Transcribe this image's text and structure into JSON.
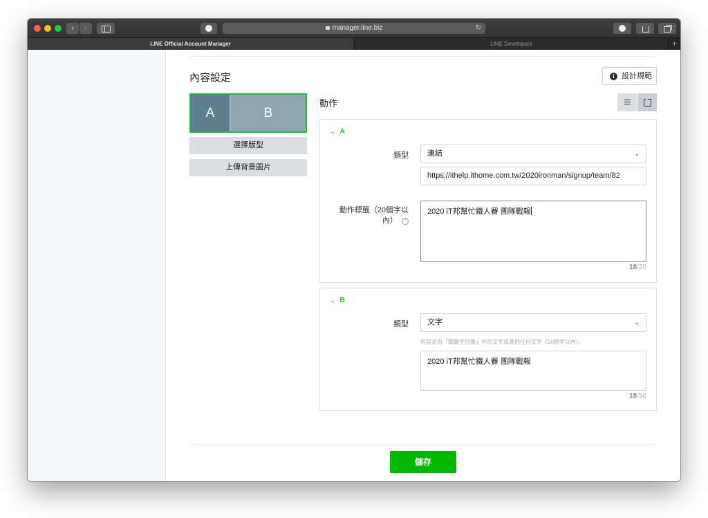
{
  "browser": {
    "url": "manager.line.biz",
    "tabs": [
      {
        "label": "LINE Official Account Manager",
        "active": true
      },
      {
        "label": "LINE Developers",
        "active": false
      }
    ],
    "new_tab_label": "+"
  },
  "page": {
    "title": "內容設定",
    "design_guide_label": "設計規範",
    "preview": {
      "cell_a": "A",
      "cell_b": "B"
    },
    "select_layout_label": "選擇版型",
    "upload_background_label": "上傳背景圖片",
    "actions_title": "動作",
    "save_label": "儲存"
  },
  "action_a": {
    "label": "A",
    "type_label": "類型",
    "type_value": "連結",
    "url_value": "https://ithelp.ithome.com.tw/2020ironman/signup/team/82",
    "action_label_line1": "動作標籤（20個字以",
    "action_label_line2": "內）",
    "action_label_value": "2020 iT邦幫忙鐵人賽 團隊戰報",
    "count_current": "18",
    "count_max": "/20"
  },
  "action_b": {
    "label": "B",
    "type_label": "類型",
    "type_value": "文字",
    "help_text": "可設定為「關鍵字回應」中的文字或其他任何文字（50個字以內）。",
    "text_value": "2020 iT邦幫忙鐵人賽 團隊戰報",
    "count_current": "18",
    "count_max": "/50"
  },
  "colors": {
    "brand_green": "#00b900",
    "accent_green": "#1fba3a"
  }
}
